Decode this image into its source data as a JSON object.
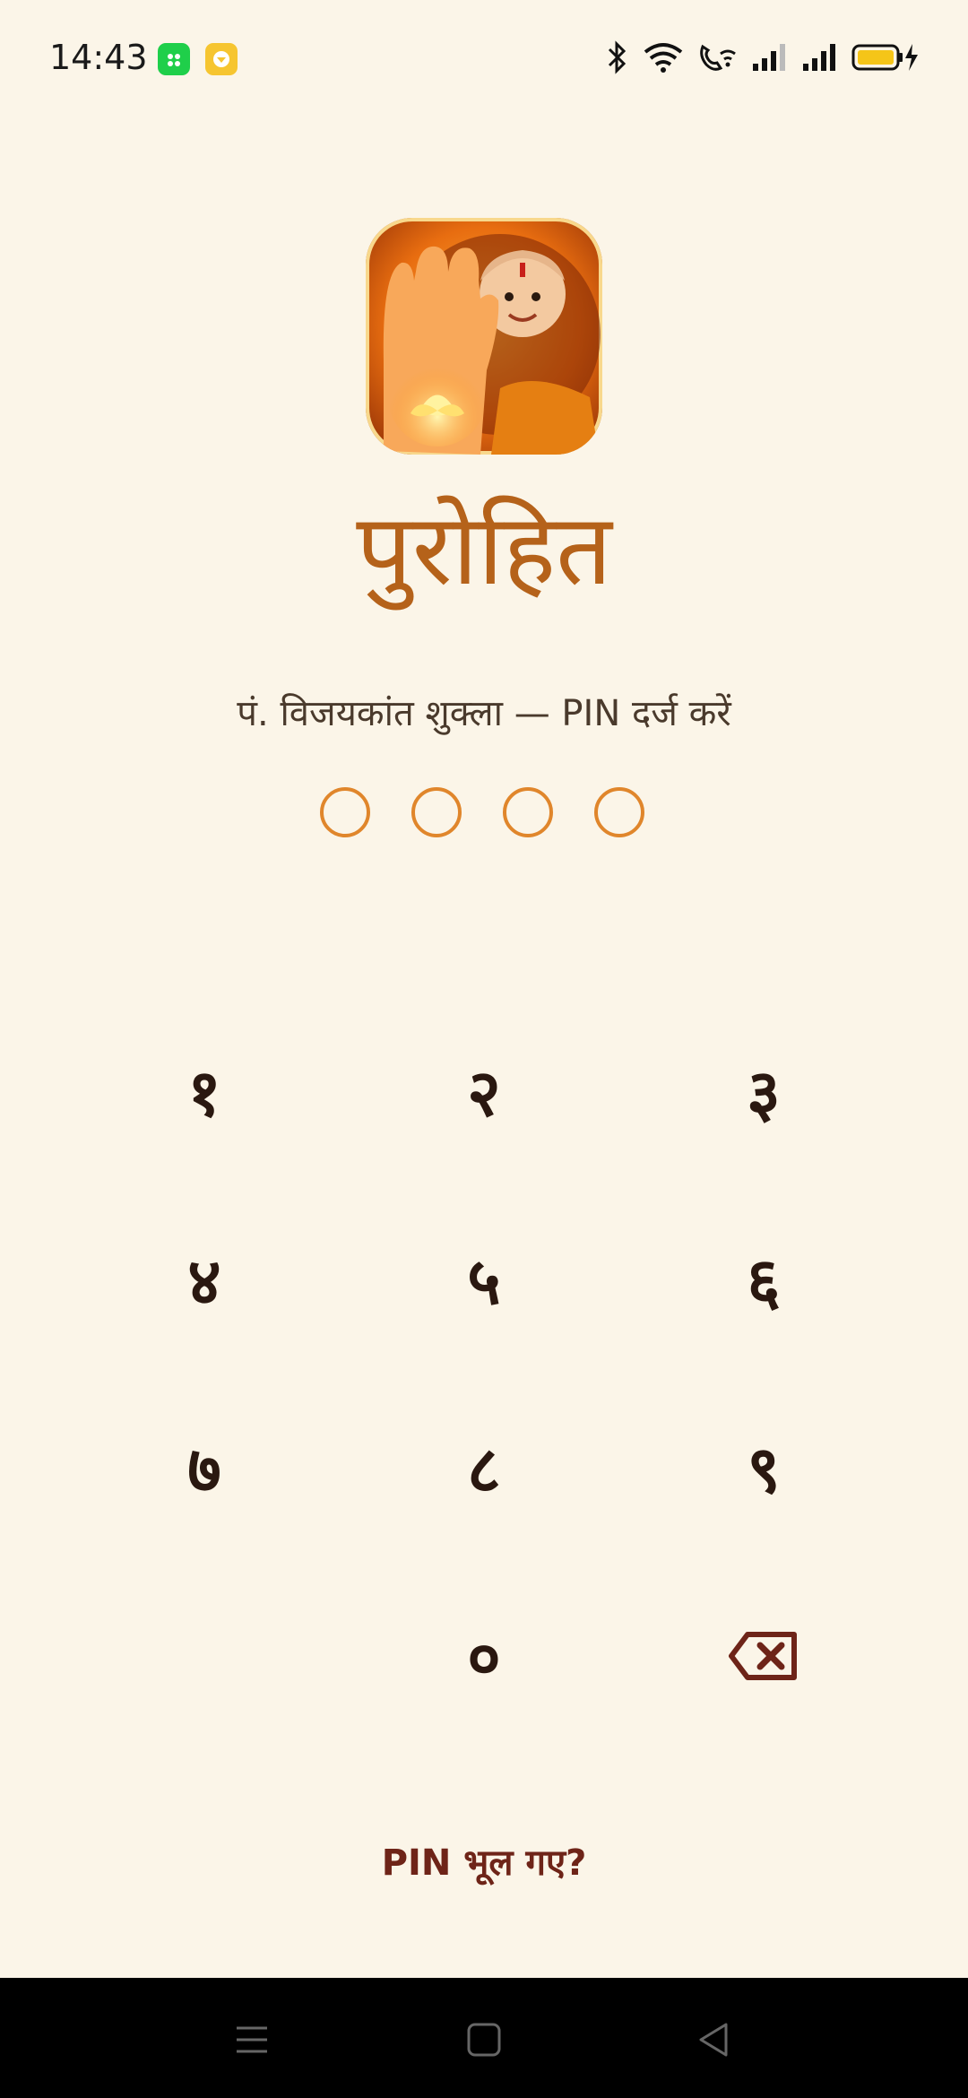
{
  "status_bar": {
    "time": "14:43",
    "icons": [
      "app-green-icon",
      "app-yellow-icon",
      "bluetooth-icon",
      "wifi-icon",
      "wifi-calling-icon",
      "signal-icon",
      "signal-icon",
      "battery-charging-icon"
    ]
  },
  "app": {
    "title": "पुरोहित",
    "subtitle": "पं. विजयकांत शुक्ला — PIN दर्ज करें",
    "logo": "purohit-logo"
  },
  "pin": {
    "length": 4,
    "entered": 0
  },
  "keypad": {
    "keys": [
      "१",
      "२",
      "३",
      "४",
      "५",
      "६",
      "७",
      "८",
      "९",
      "",
      "०",
      "backspace"
    ]
  },
  "forgot_pin": "PIN भूल गए?",
  "colors": {
    "background": "#FBF5E8",
    "accent": "#E0862B",
    "title": "#B5621A",
    "link": "#6E2418"
  },
  "nav_bar": {
    "buttons": [
      "menu-icon",
      "home-icon",
      "back-icon"
    ]
  }
}
